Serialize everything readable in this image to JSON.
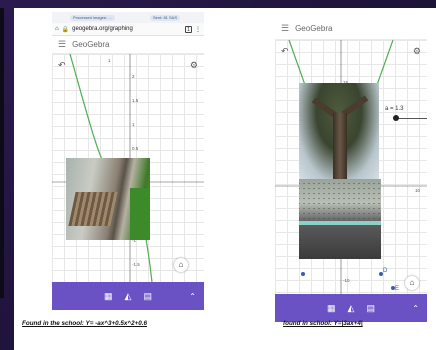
{
  "phone1": {
    "status_left": "Processed images: …",
    "status_right": "Sent: 81 SAS",
    "url": "geogebra.org/graphing",
    "tabs_count": "1",
    "app_title": "GeoGebra",
    "y_ticks": [
      "2",
      "1.5",
      "1",
      "0.5",
      "-1",
      "-1.5"
    ],
    "x_label": "1",
    "function": "-ax^3+0.5x^2+0.6"
  },
  "phone2": {
    "app_title": "GeoGebra",
    "slider_label": "a = 1.3",
    "slider_value": 1.3,
    "y_ticks": [
      "15",
      "-10"
    ],
    "x_tick": "10",
    "point_labels": [
      "D",
      "E"
    ],
    "function": "|3ax+4|"
  },
  "bottom_icons": [
    "calculator-icon",
    "shapes-icon",
    "table-icon"
  ],
  "captions": {
    "left": "Found in the school: Y= -ax^3+0.5x^2+0.6",
    "right": "found in school: Y=|3ax+4|"
  },
  "colors": {
    "accent": "#6a52c5",
    "curve": "#4caf50",
    "background": "#2a1b4f"
  }
}
